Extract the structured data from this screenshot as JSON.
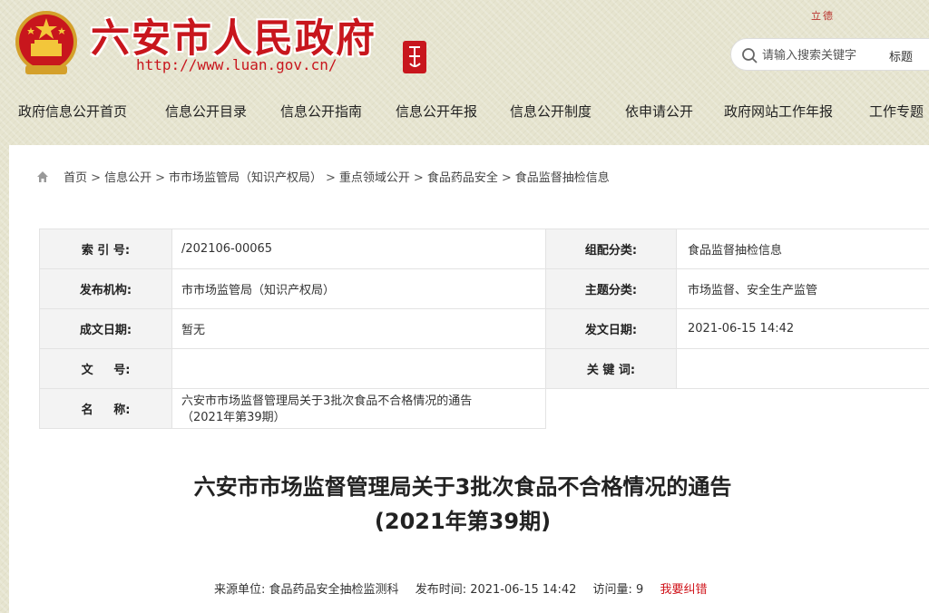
{
  "header": {
    "site_title": "六安市人民政府",
    "site_url": "http://www.luan.gov.cn/",
    "motto": "立德",
    "search": {
      "placeholder": "请输入搜索关键字",
      "scope": "标题"
    }
  },
  "nav": {
    "items": [
      "政府信息公开首页",
      "信息公开目录",
      "信息公开指南",
      "信息公开年报",
      "信息公开制度",
      "依申请公开",
      "政府网站工作年报",
      "工作专题"
    ]
  },
  "breadcrumb": {
    "items": [
      "首页",
      "信息公开",
      "市市场监管局（知识产权局）",
      "重点领域公开",
      "食品药品安全",
      "食品监督抽检信息"
    ],
    "separator": ">"
  },
  "info": {
    "index_label": "索 引 号:",
    "index_value": "/202106-00065",
    "category_label": "组配分类:",
    "category_value": "食品监督抽检信息",
    "publisher_label": "发布机构:",
    "publisher_value": "市市场监管局（知识产权局）",
    "topic_label": "主题分类:",
    "topic_value": "市场监督、安全生产监管",
    "created_label": "成文日期:",
    "created_value": "暂无",
    "issued_label": "发文日期:",
    "issued_value": "2021-06-15 14:42",
    "docno_label": "文     号:",
    "docno_value": "",
    "keywords_label": "关 键 词:",
    "keywords_value": "",
    "name_label": "名     称:",
    "name_value_line1": "六安市市场监督管理局关于3批次食品不合格情况的通告",
    "name_value_line2": "（2021年第39期）"
  },
  "document": {
    "title_line1": "六安市市场监督管理局关于3批次食品不合格情况的通告",
    "title_line2": "(2021年第39期)"
  },
  "meta": {
    "source_label": "来源单位:",
    "source_value": "食品药品安全抽检监测科",
    "time_label": "发布时间:",
    "time_value": "2021-06-15 14:42",
    "views_label": "访问量:",
    "views_value": "9",
    "correct_label": "我要纠错"
  },
  "colors": {
    "brand_red": "#c8161d",
    "page_bg": "#e6e4cf",
    "label_bg": "#f3f3f3",
    "link_red": "#d0141b"
  }
}
